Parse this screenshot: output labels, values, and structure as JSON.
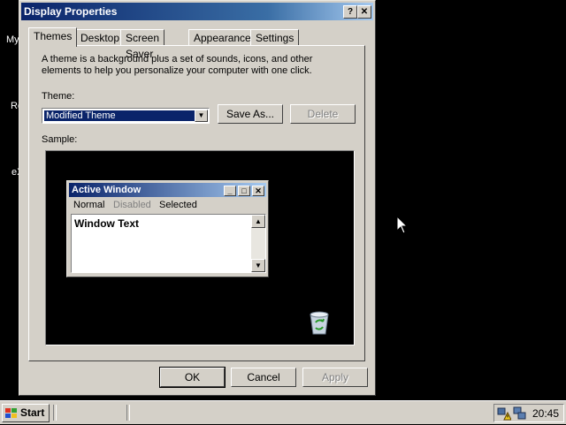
{
  "desktop": {
    "icons": [
      "My",
      "Re",
      "eX"
    ]
  },
  "dialog": {
    "title": "Display Properties",
    "titlebar_buttons": [
      "?",
      "✕"
    ],
    "tabs": [
      "Themes",
      "Desktop",
      "Screen Saver",
      "Appearance",
      "Settings"
    ],
    "active_tab": "Themes",
    "description": "A theme is a background plus a set of sounds, icons, and other elements to help you personalize your computer with one click.",
    "theme_label": "Theme:",
    "theme_value": "Modified Theme",
    "save_as_label": "Save As...",
    "delete_label": "Delete",
    "sample_label": "Sample:",
    "ok_label": "OK",
    "cancel_label": "Cancel",
    "apply_label": "Apply"
  },
  "sample_window": {
    "title": "Active Window",
    "menu": [
      "Normal",
      "Disabled",
      "Selected"
    ],
    "text": "Window Text"
  },
  "taskbar": {
    "start_label": "Start",
    "clock": "20:45"
  },
  "colors": {
    "title_active": "#0a246a",
    "face": "#d4d0c8",
    "desktop": "#000000"
  }
}
